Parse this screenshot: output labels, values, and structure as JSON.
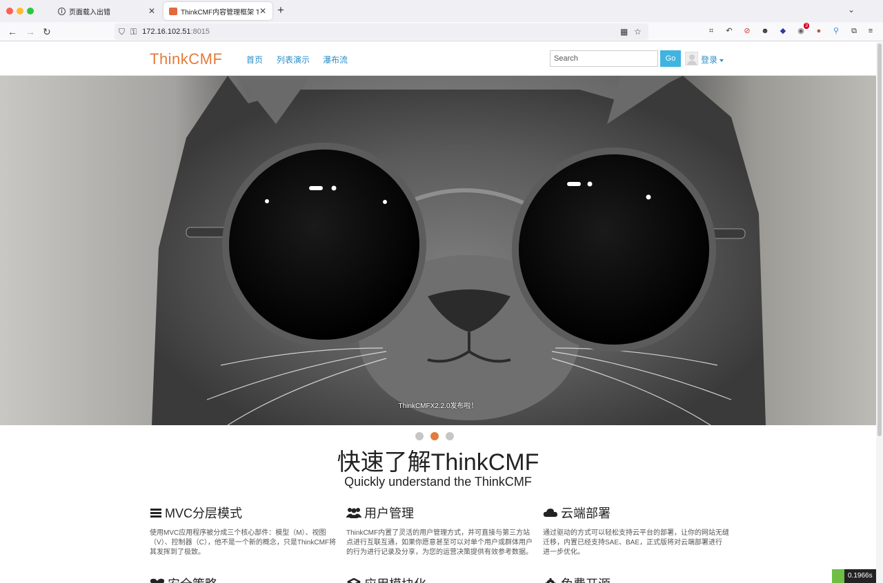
{
  "browser": {
    "tabs": [
      {
        "label": "页面载入出错"
      },
      {
        "label": "ThinkCMF内容管理框架 ThinkCMF"
      }
    ],
    "url_host": "172.16.102.51",
    "url_port": ":8015",
    "extension_badge": "3"
  },
  "site": {
    "logo_part1": "Think",
    "logo_part2": "CMF",
    "menu": [
      {
        "label": "首页"
      },
      {
        "label": "列表演示"
      },
      {
        "label": "瀑布流"
      }
    ],
    "search_placeholder": "Search",
    "search_button": "Go",
    "login_label": "登录",
    "accent_color": "#e27b3c",
    "link_color": "#2b8ec9"
  },
  "hero": {
    "caption": "ThinkCMFX2.2.0发布啦！",
    "slide_count": 3,
    "active_slide": 2
  },
  "intro": {
    "title": "快速了解ThinkCMF",
    "subtitle": "Quickly understand the ThinkCMF"
  },
  "features": [
    {
      "icon": "bars-icon",
      "title": "MVC分层模式",
      "text": "使用MVC应用程序被分成三个核心部件：模型（M）、视图（V）、控制器（C），他不是一个新的概念，只是ThinkCMF将其发挥到了极致。"
    },
    {
      "icon": "users-icon",
      "title": "用户管理",
      "text": "ThinkCMF内置了灵活的用户管理方式，并可直接与第三方站点进行互联互通，如果你愿意甚至可以对单个用户或群体用户的行为进行记录及分享，为您的运营决策提供有效参考数据。"
    },
    {
      "icon": "cloud-icon",
      "title": "云端部署",
      "text": "通过驱动的方式可以轻松支持云平台的部署，让你的网站无缝迁移，内置已经支持SAE、BAE，正式版将对云端部署进行进一步优化。"
    },
    {
      "icon": "heart-icon",
      "title": "安全策略"
    },
    {
      "icon": "cube-icon",
      "title": "应用模块化"
    },
    {
      "icon": "gear-icon",
      "title": "免费开源"
    }
  ],
  "debug_timer": "0.1966s"
}
